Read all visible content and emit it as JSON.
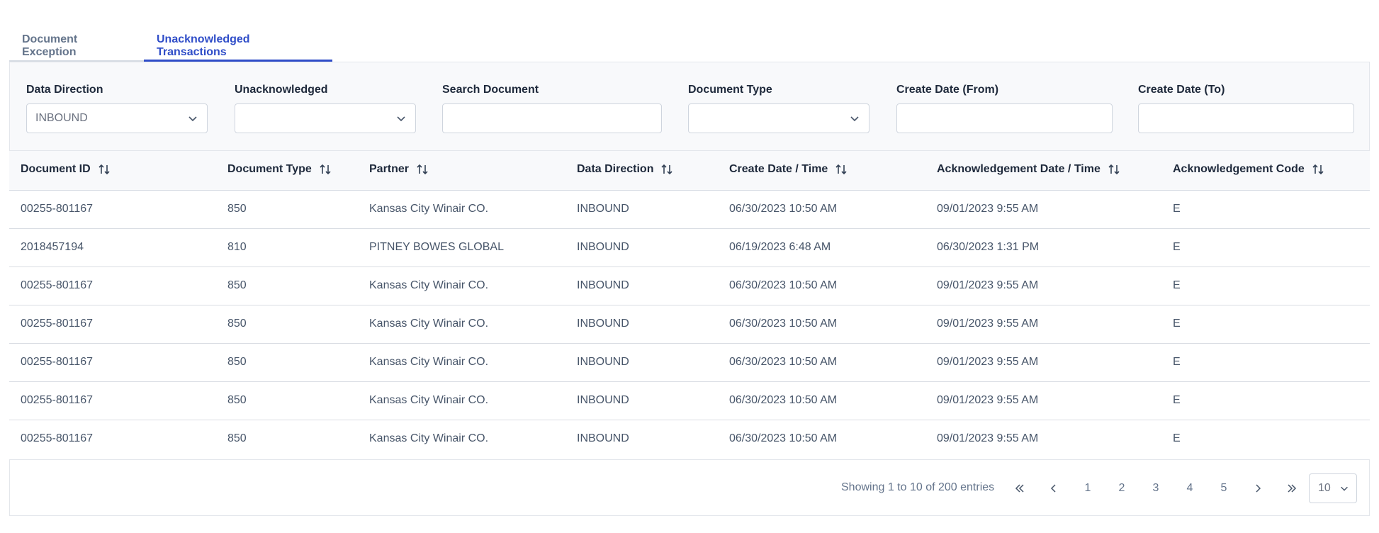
{
  "tabs": [
    {
      "label": "Document Exception",
      "active": false
    },
    {
      "label": "Unacknowledged Transactions",
      "active": true
    }
  ],
  "filters": {
    "data_direction": {
      "label": "Data Direction",
      "value": "INBOUND"
    },
    "unacknowledged": {
      "label": "Unacknowledged",
      "value": ""
    },
    "search_document": {
      "label": "Search Document",
      "value": ""
    },
    "document_type": {
      "label": "Document Type",
      "value": ""
    },
    "create_date_from": {
      "label": "Create Date (From)",
      "value": ""
    },
    "create_date_to": {
      "label": "Create Date (To)",
      "value": ""
    }
  },
  "table": {
    "columns": [
      "Document ID",
      "Document Type",
      "Partner",
      "Data Direction",
      "Create Date / Time",
      "Acknowledgement Date / Time",
      "Acknowledgement Code"
    ],
    "rows": [
      [
        "00255-801167",
        "850",
        "Kansas City Winair CO.",
        "INBOUND",
        "06/30/2023 10:50 AM",
        "09/01/2023 9:55 AM",
        "E"
      ],
      [
        "2018457194",
        "810",
        "PITNEY BOWES GLOBAL",
        "INBOUND",
        "06/19/2023 6:48 AM",
        "06/30/2023 1:31 PM",
        "E"
      ],
      [
        "00255-801167",
        "850",
        "Kansas City Winair CO.",
        "INBOUND",
        "06/30/2023 10:50 AM",
        "09/01/2023 9:55 AM",
        "E"
      ],
      [
        "00255-801167",
        "850",
        "Kansas City Winair CO.",
        "INBOUND",
        "06/30/2023 10:50 AM",
        "09/01/2023 9:55 AM",
        "E"
      ],
      [
        "00255-801167",
        "850",
        "Kansas City Winair CO.",
        "INBOUND",
        "06/30/2023 10:50 AM",
        "09/01/2023 9:55 AM",
        "E"
      ],
      [
        "00255-801167",
        "850",
        "Kansas City Winair CO.",
        "INBOUND",
        "06/30/2023 10:50 AM",
        "09/01/2023 9:55 AM",
        "E"
      ],
      [
        "00255-801167",
        "850",
        "Kansas City Winair CO.",
        "INBOUND",
        "06/30/2023 10:50 AM",
        "09/01/2023 9:55 AM",
        "E"
      ]
    ]
  },
  "pagination": {
    "summary": "Showing 1 to 10 of 200 entries",
    "pages": [
      "1",
      "2",
      "3",
      "4",
      "5"
    ],
    "page_size": "10"
  },
  "icons": {
    "sort": "sort-arrows-icon",
    "chevron": "chevron-down-icon",
    "first": "double-chevron-left-icon",
    "prev": "chevron-left-icon",
    "next": "chevron-right-icon",
    "last": "double-chevron-right-icon"
  },
  "colors": {
    "accent": "#2f4dc8",
    "text": "#334155",
    "muted": "#64748b",
    "border": "#d6dbe3",
    "panel": "#f8f9fb"
  }
}
